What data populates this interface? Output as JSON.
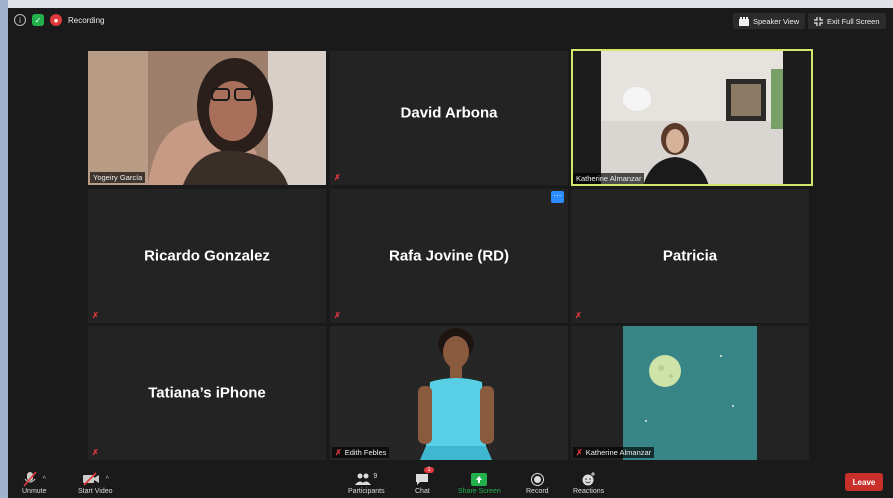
{
  "topbar": {
    "recording_label": "Recording",
    "speaker_view_label": "Speaker View",
    "exit_fullscreen_label": "Exit Full Screen"
  },
  "tiles": [
    {
      "id": "yogeiry",
      "label": "Yogeiry García",
      "video": true
    },
    {
      "id": "david",
      "display_name": "David Arbona",
      "video": false
    },
    {
      "id": "katherine-video",
      "label": "Katherine Almanzar",
      "video": true,
      "active_speaker": true
    },
    {
      "id": "ricardo",
      "display_name": "Ricardo Gonzalez",
      "video": false
    },
    {
      "id": "rafa",
      "display_name": "Rafa Jovine (RD)",
      "video": false
    },
    {
      "id": "patricia",
      "display_name": "Patricia",
      "video": false
    },
    {
      "id": "tatiana",
      "display_name": "Tatiana’s iPhone",
      "video": false
    },
    {
      "id": "edith",
      "label": "Edith Febles",
      "video": true
    },
    {
      "id": "katherine-moon",
      "label": "Katherine Almanzar",
      "video": true
    }
  ],
  "toolbar": {
    "unmute_label": "Unmute",
    "start_video_label": "Start Video",
    "participants_label": "Participants",
    "participants_count": "9",
    "chat_label": "Chat",
    "chat_badge": "1",
    "share_screen_label": "Share Screen",
    "record_label": "Record",
    "reactions_label": "Reactions",
    "leave_label": "Leave"
  },
  "more_button_label": "···",
  "colors": {
    "active_speaker_border": "#d3e86a",
    "share_screen_green": "#22b14c",
    "leave_red": "#c9302c",
    "muted_red": "#e0393e"
  }
}
